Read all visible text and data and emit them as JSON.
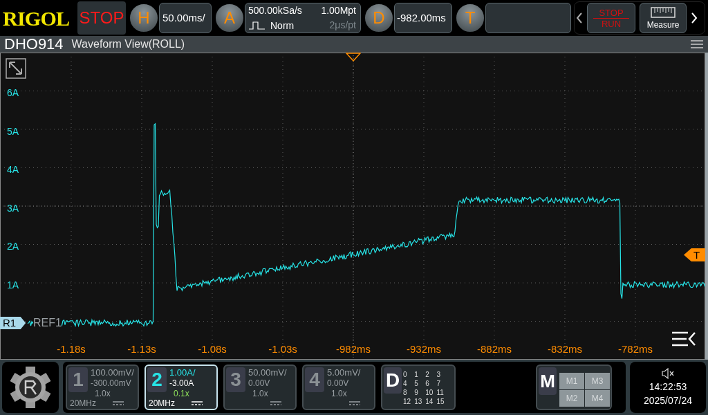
{
  "header": {
    "logo": "RIGOL",
    "run_state": "STOP",
    "horizontal": {
      "key": "H",
      "scale": "50.00ms/"
    },
    "acquire": {
      "key": "A",
      "sample_rate": "500.00kSa/s",
      "memory_depth": "1.00Mpt",
      "mode": "Norm",
      "time_per_point": "2μs/pt"
    },
    "delay": {
      "key": "D",
      "offset": "-982.00ms"
    },
    "trigger": {
      "key": "T"
    },
    "nav_buttons": [
      {
        "kind": "stop_run",
        "top": "STOP",
        "bottom": "RUN"
      },
      {
        "kind": "measure",
        "label": "Measure"
      }
    ]
  },
  "model": "DHO914",
  "view": {
    "title": "Waveform View(ROLL)",
    "y_labels": [
      "6A",
      "5A",
      "4A",
      "3A",
      "2A",
      "1A"
    ],
    "x_labels": [
      "-1.18s",
      "-1.13s",
      "-1.08s",
      "-1.03s",
      "-982ms",
      "-932ms",
      "-882ms",
      "-832ms",
      "-782ms"
    ],
    "ref_marker": "R1",
    "ref_label": "REF1",
    "trigger_marker": "T"
  },
  "channels": [
    {
      "number": "1",
      "scale": "100.00mV/",
      "offset": "-300.00mV",
      "probe": "1.0x",
      "bandwidth": "20MHz",
      "selected": false
    },
    {
      "number": "2",
      "scale": "1.00A/",
      "offset": "-3.00A",
      "probe": "0.1x",
      "bandwidth": "20MHz",
      "selected": true
    },
    {
      "number": "3",
      "scale": "50.00mV/",
      "offset": "0.00V",
      "probe": "1.0x",
      "selected": false
    },
    {
      "number": "4",
      "scale": "5.00mV/",
      "offset": "0.00V",
      "probe": "1.0x",
      "selected": false
    }
  ],
  "digital": {
    "key": "D",
    "bits": [
      "0",
      "1",
      "2",
      "3",
      "4",
      "5",
      "6",
      "7",
      "8",
      "9",
      "10",
      "11",
      "12",
      "13",
      "14",
      "15"
    ]
  },
  "math": {
    "key": "M",
    "slots": [
      "M1",
      "M3",
      "M2",
      "M4"
    ]
  },
  "status": {
    "time": "14:22:53",
    "date": "2025/07/24"
  }
}
